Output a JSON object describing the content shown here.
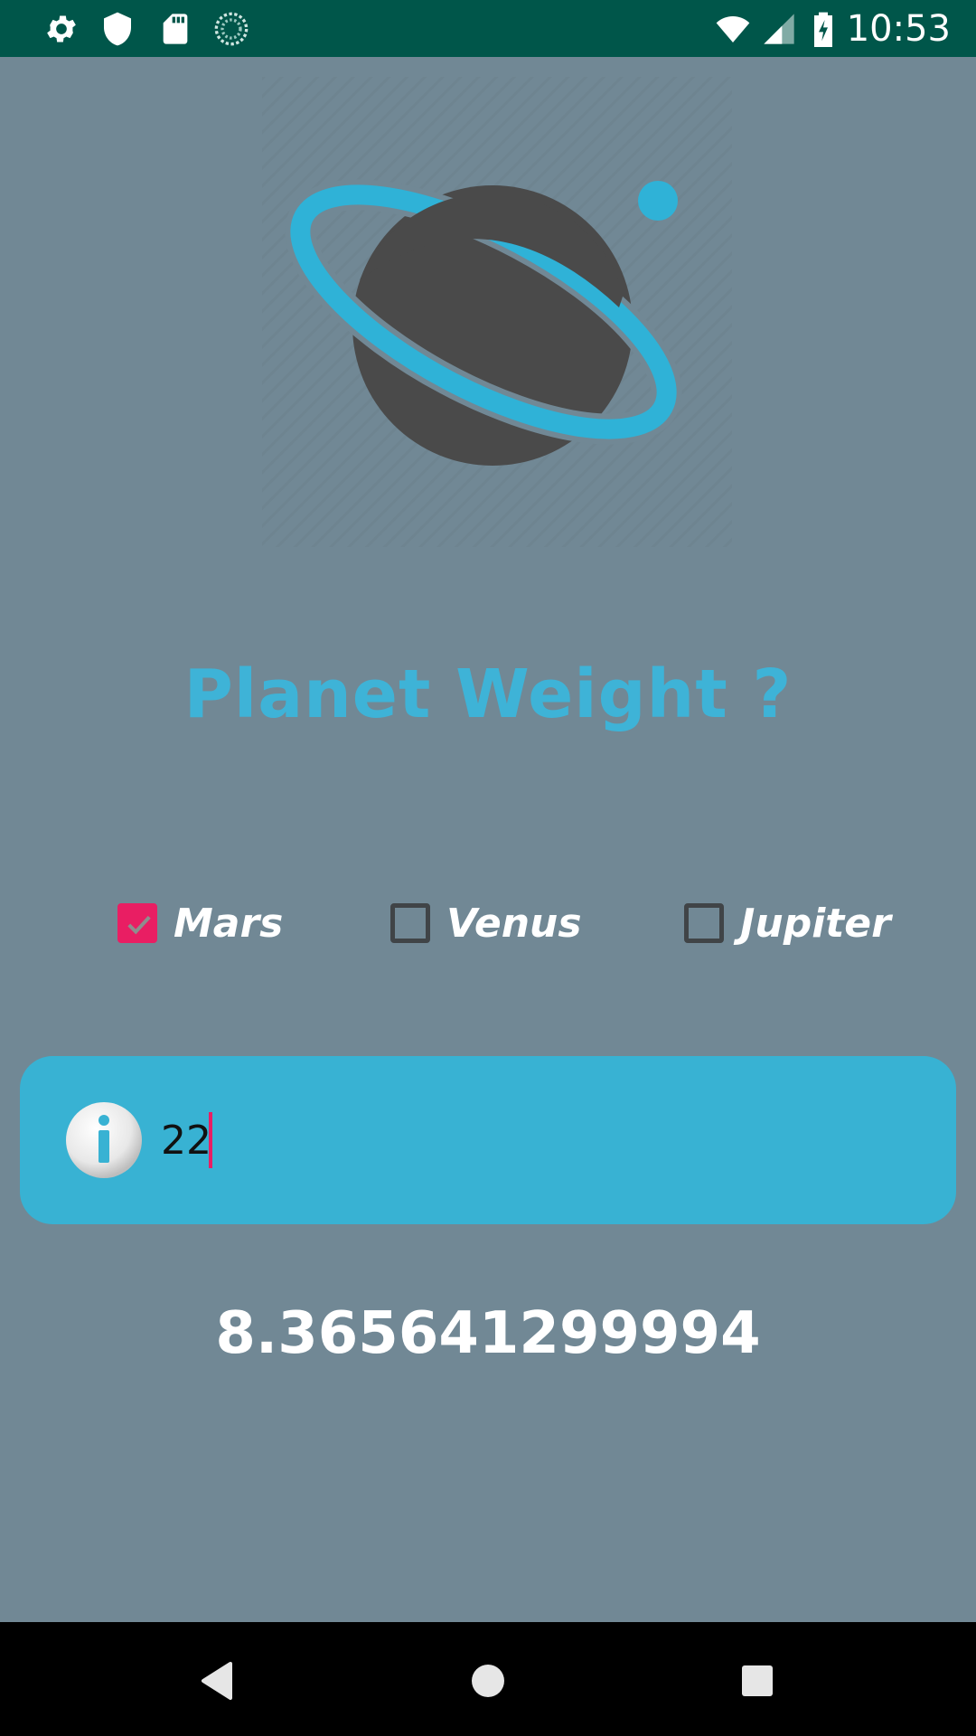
{
  "status_bar": {
    "time": "10:53",
    "left_icons": [
      "settings-icon",
      "shield-icon",
      "sd-card-icon",
      "sync-icon"
    ],
    "right_icons": [
      "wifi-icon",
      "signal-icon",
      "battery-charging-icon"
    ]
  },
  "app": {
    "title": "Planet Weight ?",
    "logo": "planet-logo",
    "planets": [
      {
        "label": "Mars",
        "checked": true
      },
      {
        "label": "Venus",
        "checked": false
      },
      {
        "label": "Jupiter",
        "checked": false
      }
    ],
    "weight_input": {
      "value": "22",
      "icon": "info-icon"
    },
    "result": "8.365641299994"
  },
  "colors": {
    "background": "#718895",
    "status_bar": "#00564a",
    "accent": "#3eb3d7",
    "input_card": "#38b2d3",
    "checkbox_checked": "#e91e63",
    "planet": "#4a4a4a"
  },
  "nav_bar": {
    "buttons": [
      "back-icon",
      "home-icon",
      "recents-icon"
    ]
  }
}
